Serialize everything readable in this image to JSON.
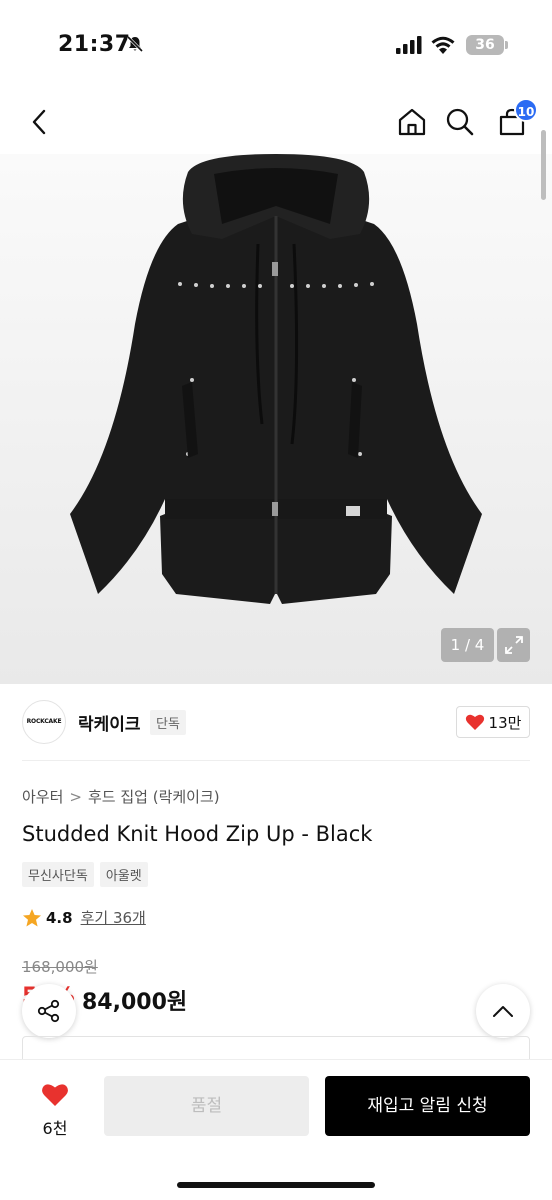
{
  "status": {
    "time": "21:37",
    "battery": "36"
  },
  "nav": {
    "cart_count": "10",
    "icons": [
      "back-icon",
      "home-icon",
      "search-icon",
      "cart-icon"
    ]
  },
  "gallery": {
    "counter": "1 / 4",
    "total": 4,
    "current": 1
  },
  "brand": {
    "logo_text": "ROCKCAKE",
    "name": "락케이크",
    "tag": "단독",
    "likes": "13만"
  },
  "product": {
    "breadcrumb": [
      "아우터",
      "후드 집업 (락케이크)"
    ],
    "title": "Studded Knit Hood Zip Up - Black",
    "tags": [
      "무신사단독",
      "아울렛"
    ],
    "rating": "4.8",
    "reviews": "후기 36개",
    "original_price": "168,000원",
    "discount": "50%",
    "sale_price": "84,000원"
  },
  "bottom": {
    "wish_count": "6천",
    "option_label": "품절",
    "notify_label": "재입고 알림 신청"
  },
  "colors": {
    "accent": "#2b6bf3",
    "sale_red": "#e8322e",
    "heart": "#e8322e"
  }
}
